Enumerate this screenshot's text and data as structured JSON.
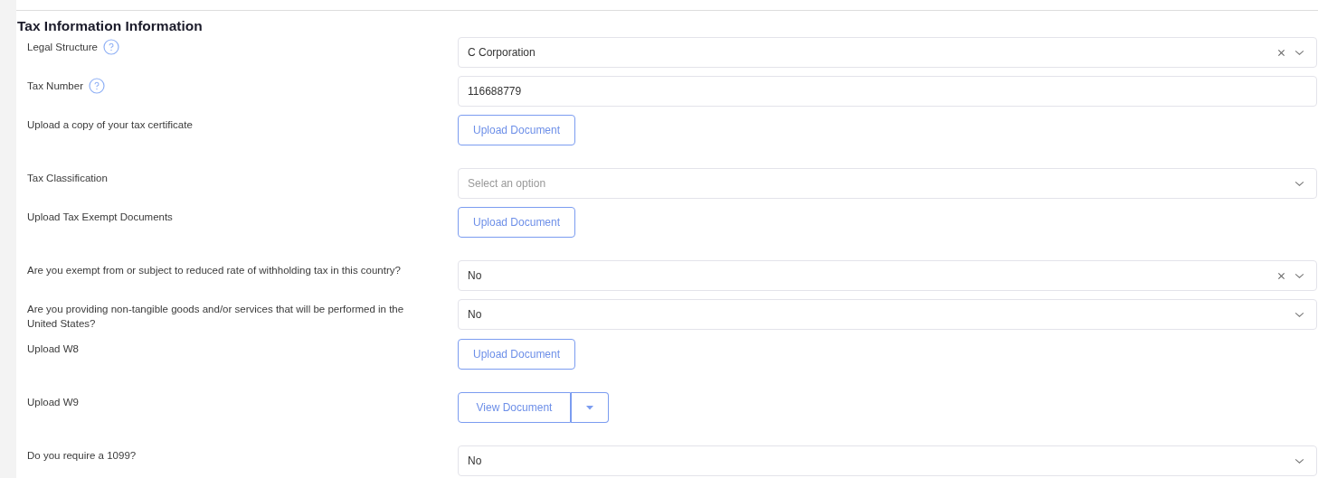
{
  "section": {
    "title": "Tax Information Information"
  },
  "fields": [
    {
      "kind": "select",
      "label": "Legal Structure",
      "help": true,
      "value": "C Corporation",
      "clearable": true
    },
    {
      "kind": "input",
      "label": "Tax Number",
      "help": true,
      "value": "116688779"
    },
    {
      "kind": "upload",
      "label": "Upload a copy of your tax certificate",
      "help": false,
      "button": "Upload Document"
    },
    {
      "kind": "select",
      "label": "Tax Classification",
      "help": false,
      "placeholder": "Select an option",
      "clearable": false
    },
    {
      "kind": "upload",
      "label": "Upload Tax Exempt Documents",
      "help": false,
      "button": "Upload Document"
    },
    {
      "kind": "select",
      "label": "Are you exempt from or subject to reduced rate of withholding tax in this country?",
      "help": false,
      "value": "No",
      "clearable": true
    },
    {
      "kind": "select",
      "label": "Are you providing non-tangible goods and/or services that will be performed in the United States?",
      "help": false,
      "value": "No",
      "clearable": false
    },
    {
      "kind": "upload",
      "label": "Upload W8",
      "help": false,
      "button": "Upload Document"
    },
    {
      "kind": "split",
      "label": "Upload W9",
      "help": false,
      "button": "View Document"
    },
    {
      "kind": "select",
      "label": "Do you require a 1099?",
      "help": false,
      "value": "No",
      "clearable": false
    }
  ]
}
